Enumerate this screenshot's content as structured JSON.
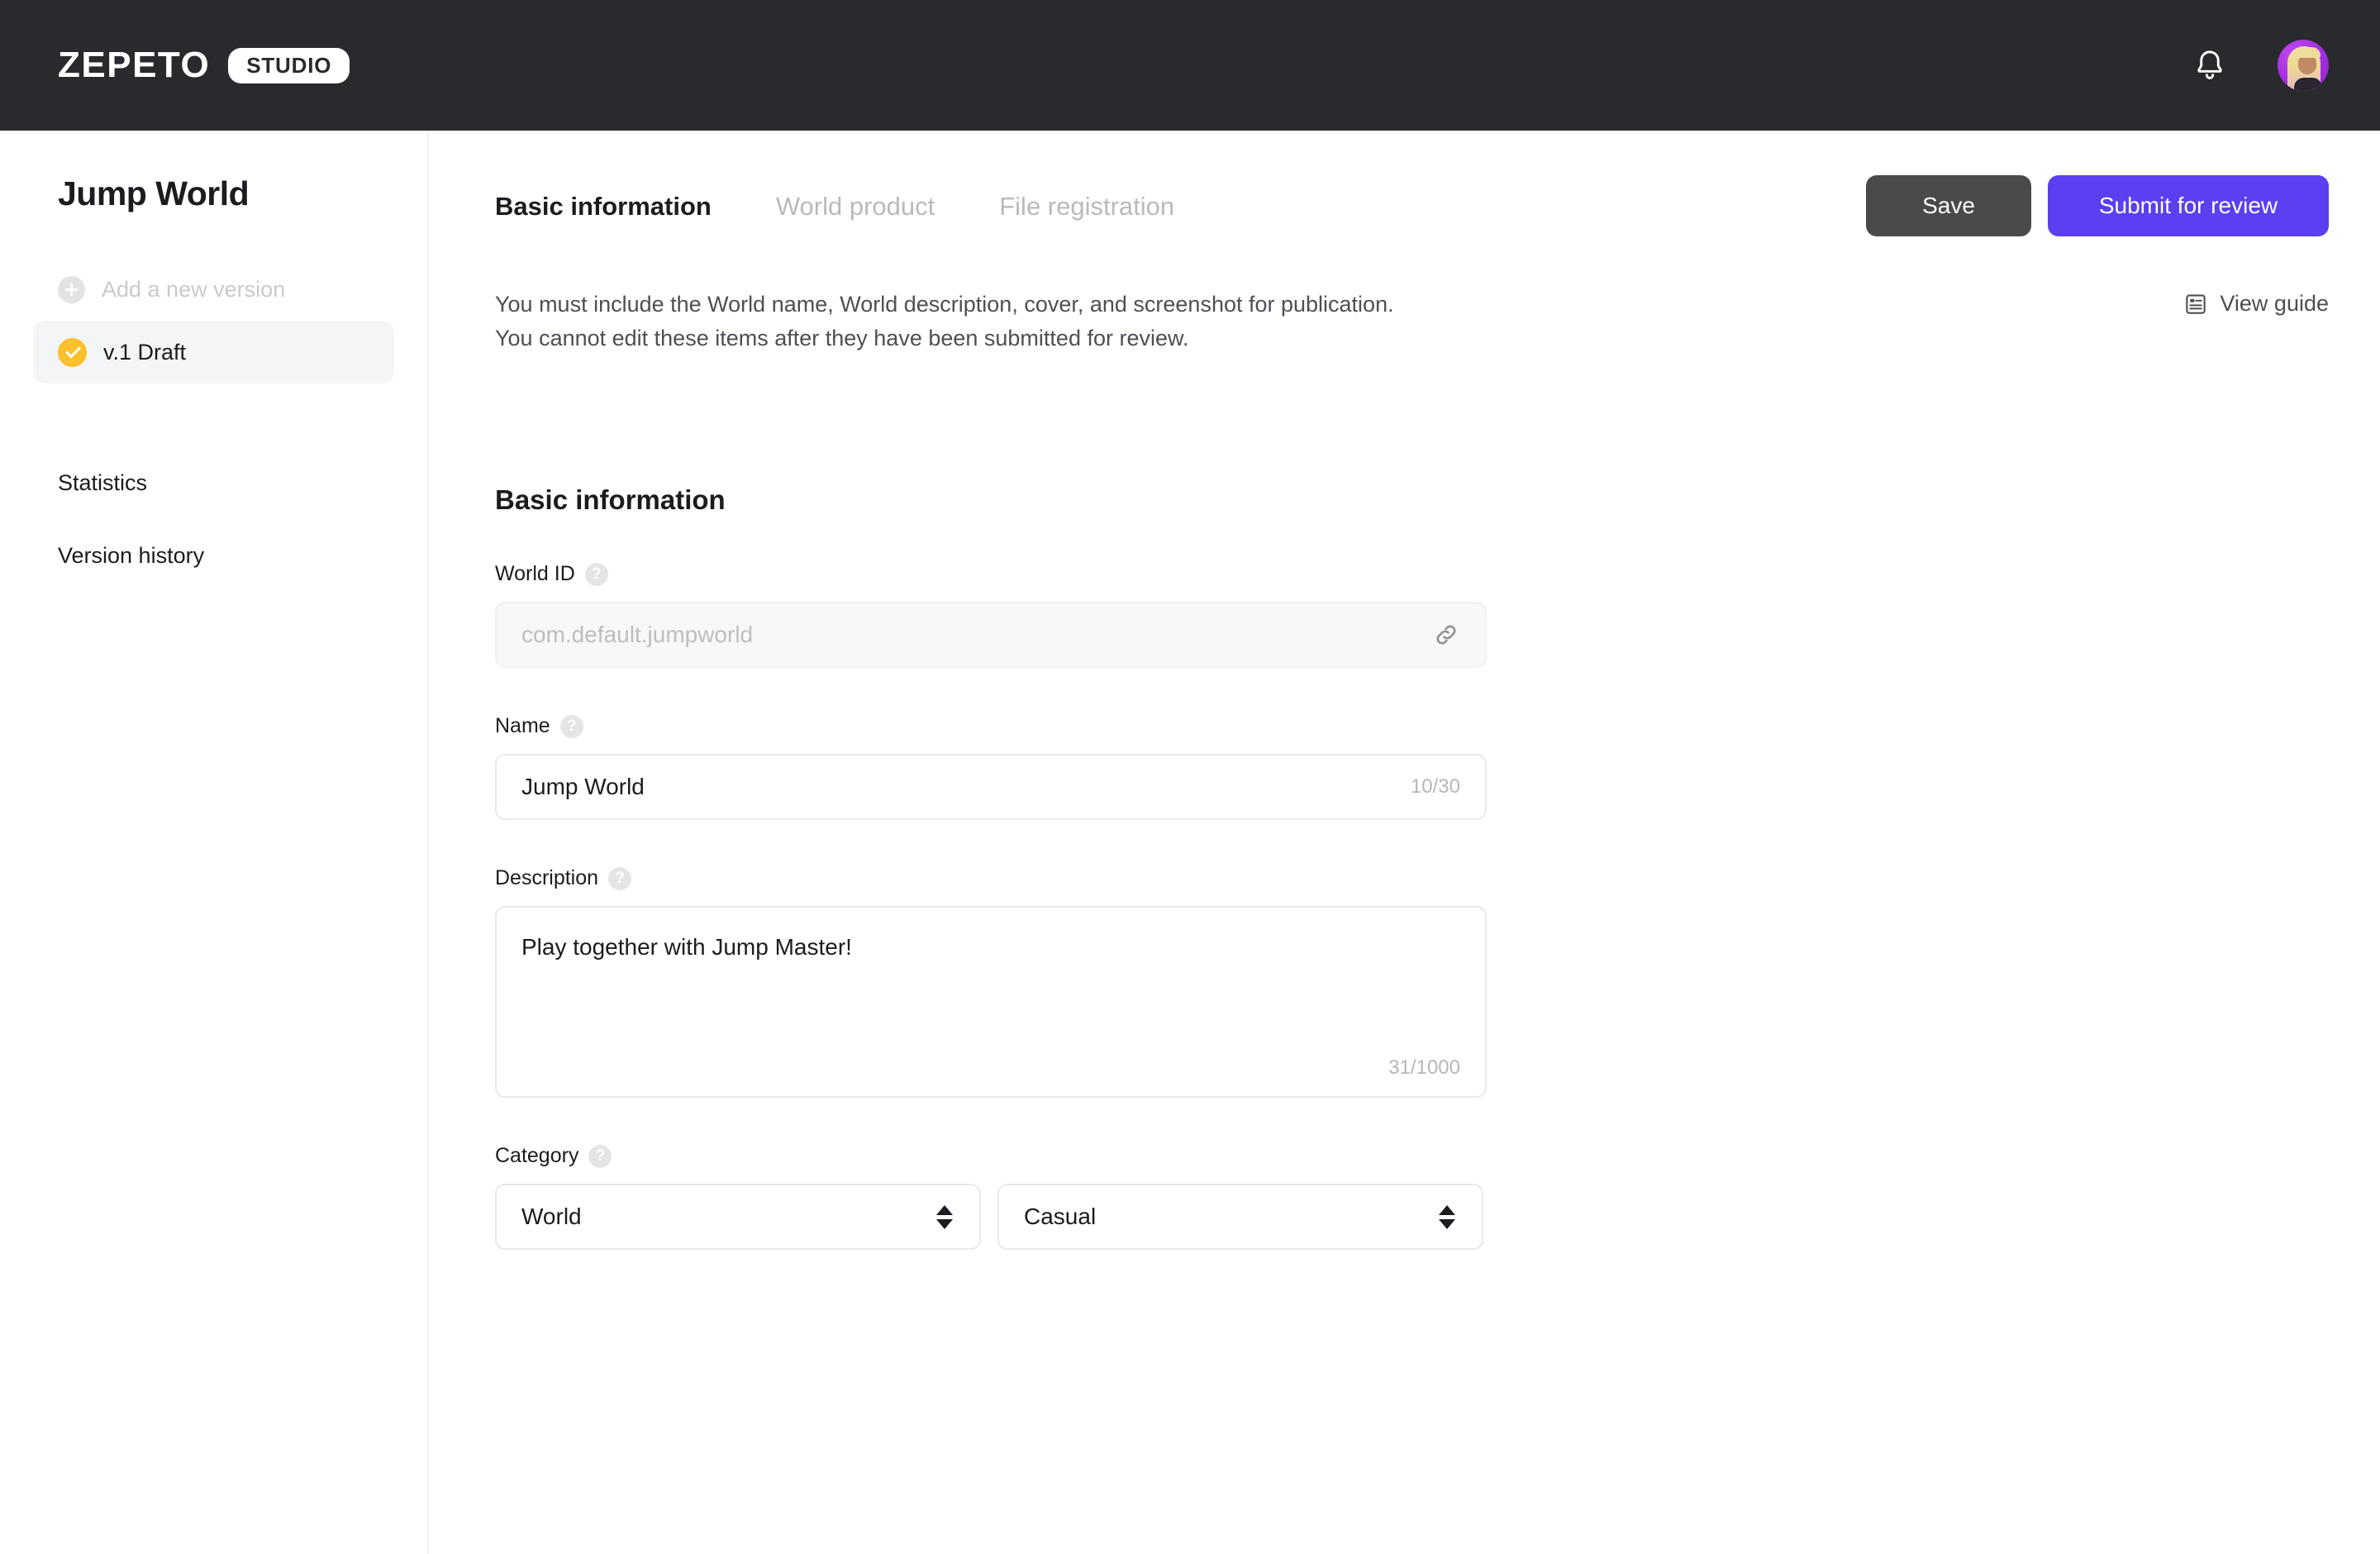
{
  "topbar": {
    "brand_word": "ZEPETO",
    "brand_badge": "STUDIO",
    "bell_icon": "bell-icon",
    "avatar_icon": "avatar"
  },
  "sidebar": {
    "title": "Jump World",
    "add_version": {
      "label": "Add a new version",
      "icon": "plus-circle-icon"
    },
    "versions": [
      {
        "label": "v.1 Draft",
        "icon": "check-circle-icon",
        "status_color": "#fbc02d",
        "active": true
      }
    ],
    "links": [
      {
        "label": "Statistics"
      },
      {
        "label": "Version history"
      }
    ]
  },
  "main": {
    "tabs": [
      {
        "label": "Basic information",
        "active": true
      },
      {
        "label": "World product",
        "active": false
      },
      {
        "label": "File registration",
        "active": false
      }
    ],
    "actions": {
      "save_label": "Save",
      "submit_label": "Submit for review",
      "save_color": "#4a4a4a",
      "submit_color": "#5b3ff0"
    },
    "notice": {
      "line1": "You must include the World name, World description, cover, and screenshot for publication.",
      "line2": "You cannot edit these items after they have been submitted for review."
    },
    "view_guide": {
      "label": "View guide",
      "icon": "document-icon"
    },
    "section_title": "Basic information",
    "fields": {
      "world_id": {
        "label": "World ID",
        "help": "?",
        "placeholder": "com.default.jumpworld",
        "value": "",
        "disabled": true,
        "trailing_icon": "link-icon"
      },
      "name": {
        "label": "Name",
        "help": "?",
        "value": "Jump World",
        "counter": "10/30"
      },
      "description": {
        "label": "Description",
        "help": "?",
        "value": "Play together with Jump Master!",
        "counter": "31/1000"
      },
      "category": {
        "label": "Category",
        "help": "?",
        "primary": {
          "value": "World"
        },
        "secondary": {
          "value": "Casual"
        }
      }
    }
  }
}
